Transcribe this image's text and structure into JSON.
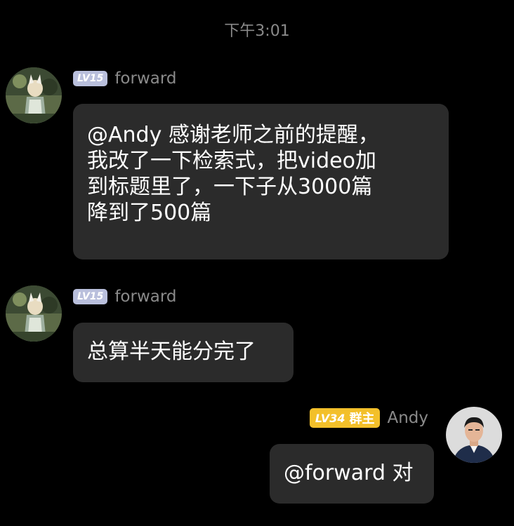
{
  "timestamp": "下午3:01",
  "messages": [
    {
      "level": "LV15",
      "nickname": "forward",
      "avatar_icon": "anime-girl-avatar",
      "lines": [
        "@Andy 感谢老师之前的提醒，",
        "我改了一下检索式，把video加",
        "到标题里了，一下子从3000篇",
        "降到了500篇"
      ]
    },
    {
      "level": "LV15",
      "nickname": "forward",
      "avatar_icon": "anime-girl-avatar",
      "lines": [
        "总算半天能分完了"
      ]
    },
    {
      "level": "LV34",
      "role": "群主",
      "nickname": "Andy",
      "avatar_icon": "man-portrait-avatar",
      "lines": [
        "@forward 对"
      ]
    }
  ],
  "colors": {
    "background": "#000000",
    "bubble": "#2b2b2b",
    "level_gray": "#b9bfdc",
    "level_gold": "#f3c02a",
    "muted_text": "#8a8a8a"
  }
}
